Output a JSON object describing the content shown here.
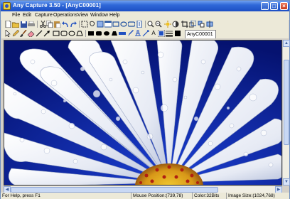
{
  "window": {
    "title": "Any Capture 3.50 - [AnyC00001]",
    "controls": {
      "minimize": "_",
      "maximize": "□",
      "close": "×"
    }
  },
  "menu": [
    "File",
    "Edit",
    "Capture",
    "Operations",
    "View",
    "Window",
    "Help"
  ],
  "toolbar1": {
    "icons": [
      "new-icon",
      "open-icon",
      "save-icon",
      "print-icon",
      "cut-icon",
      "copy-icon",
      "paste-icon",
      "undo-icon",
      "redo-icon",
      "select-icon",
      "lasso-icon",
      "fullscreen-capture-icon",
      "window-capture-icon",
      "region-capture-icon",
      "ellipse-capture-icon",
      "freehand-capture-icon",
      "scroll-capture-icon",
      "zoom-in-icon",
      "zoom-out-icon",
      "brightness-icon",
      "contrast-icon",
      "crop-icon",
      "resize-icon",
      "rotate-icon",
      "flip-icon"
    ]
  },
  "toolbar2": {
    "icons": [
      "cursor-icon",
      "pencil-icon",
      "brush-icon",
      "eraser-icon",
      "line-icon",
      "arrow-icon",
      "rectangle-icon",
      "rounded-rectangle-icon",
      "ellipse-icon",
      "polygon-icon",
      "filled-rectangle-icon",
      "filled-ellipse-icon",
      "highlight-icon",
      "text-icon",
      "color-picker-icon",
      "line-width-icon",
      "fill-color-icon"
    ],
    "text_tool_glyph": "A"
  },
  "document": {
    "tab_label": "AnyC00001"
  },
  "status": {
    "help": "For Help, press F1",
    "mouse_position": "Mouse Position:(739,78)",
    "color": "Color:32Bits",
    "image_size": "Image Size:(1024,768)"
  },
  "colors": {
    "titlebar": "#1d4fc4",
    "canvas_bg": "#0a1f9a",
    "petal": "#f4f6fb",
    "flower_center": "#d8a018"
  }
}
